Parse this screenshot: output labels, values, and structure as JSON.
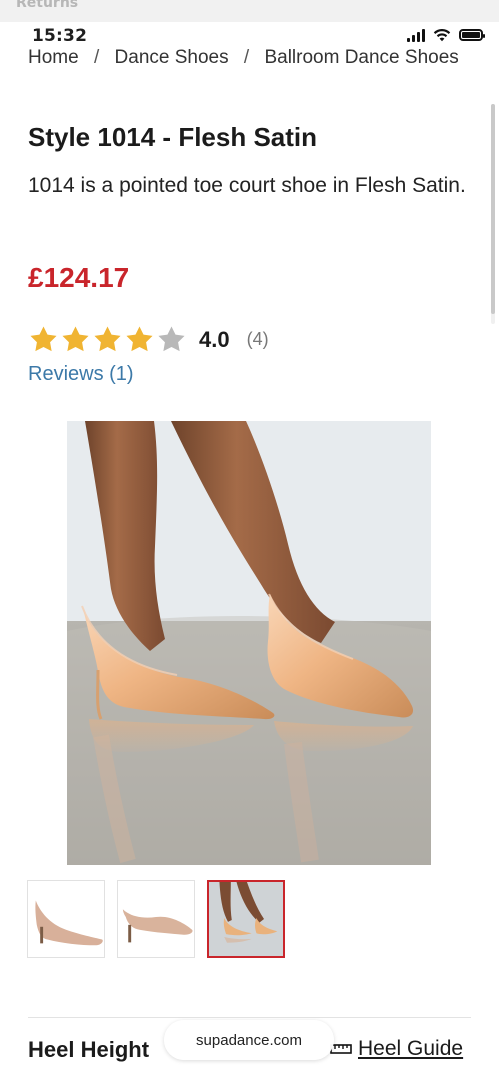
{
  "top_strip": {
    "text": "Returns"
  },
  "status_bar": {
    "time": "15:32",
    "icons": [
      "signal-icon",
      "wifi-icon",
      "battery-icon"
    ]
  },
  "breadcrumb": {
    "items": [
      "Home",
      "Dance Shoes",
      "Ballroom Dance Shoes"
    ],
    "separator": "/"
  },
  "product": {
    "title": "Style 1014 - Flesh Satin",
    "description": "1014 is a pointed toe court shoe in Flesh Satin.",
    "price": "£124.17",
    "rating_value": "4.0",
    "rating_count": "(4)",
    "reviews_link": "Reviews (1)"
  },
  "footer": {
    "heel_height_label": "Heel Height",
    "heel_guide_label": "Heel Guide"
  },
  "browser": {
    "url": "supadance.com"
  },
  "colors": {
    "price": "#c9252b",
    "link": "#3c79a8",
    "star_filled": "#f0b432",
    "star_empty": "#b8b8b8",
    "active_thumb_border": "#c9252b"
  }
}
